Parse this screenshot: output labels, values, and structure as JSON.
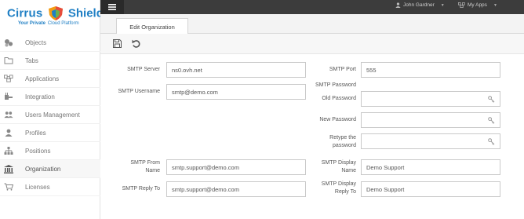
{
  "logo": {
    "brand_part1": "Cirrus",
    "brand_part2": "Shield",
    "tagline_part1": "Your Private",
    "tagline_part2": "Cloud Platform"
  },
  "sidebar": {
    "items": [
      {
        "label": "Objects",
        "icon": "objects-icon",
        "active": false
      },
      {
        "label": "Tabs",
        "icon": "folder-icon",
        "active": false
      },
      {
        "label": "Applications",
        "icon": "applications-icon",
        "active": false
      },
      {
        "label": "Integration",
        "icon": "integration-icon",
        "active": false
      },
      {
        "label": "Users Management",
        "icon": "users-icon",
        "active": false
      },
      {
        "label": "Profiles",
        "icon": "user-icon",
        "active": false
      },
      {
        "label": "Positions",
        "icon": "hierarchy-icon",
        "active": false
      },
      {
        "label": "Organization",
        "icon": "bank-icon",
        "active": true
      },
      {
        "label": "Licenses",
        "icon": "cart-icon",
        "active": false
      }
    ]
  },
  "topbar": {
    "user_name": "John Gardner",
    "apps_label": "My Apps"
  },
  "tabs": {
    "active_tab": "Edit Organization"
  },
  "form": {
    "smtp_server_label": "SMTP Server",
    "smtp_server_value": "ns0.ovh.net",
    "smtp_port_label": "SMTP Port",
    "smtp_port_value": "555",
    "smtp_password_label": "SMTP Password",
    "smtp_username_label": "SMTP Username",
    "smtp_username_value": "smtp@demo.com",
    "old_password_label": "Old Password",
    "new_password_label": "New Password",
    "retype_password_label_1": "Retype the",
    "retype_password_label_2": "password",
    "smtp_from_name_label_1": "SMTP From",
    "smtp_from_name_label_2": "Name",
    "smtp_from_name_value": "smtp.support@demo.com",
    "smtp_display_name_label_1": "SMTP Display",
    "smtp_display_name_label_2": "Name",
    "smtp_display_name_value": "Demo Support",
    "smtp_reply_to_label": "SMTP Reply To",
    "smtp_reply_to_value": "smtp.support@demo.com",
    "smtp_display_reply_to_label_1": "SMTP Display",
    "smtp_display_reply_to_label_2": "Reply To",
    "smtp_display_reply_to_value": "Demo Support"
  },
  "colors": {
    "brand_blue": "#1f7fc4",
    "shield_green": "#6ab04c",
    "shield_orange": "#f39c12",
    "shield_red": "#e74c3c",
    "topbar_bg": "#3c3c3c"
  }
}
